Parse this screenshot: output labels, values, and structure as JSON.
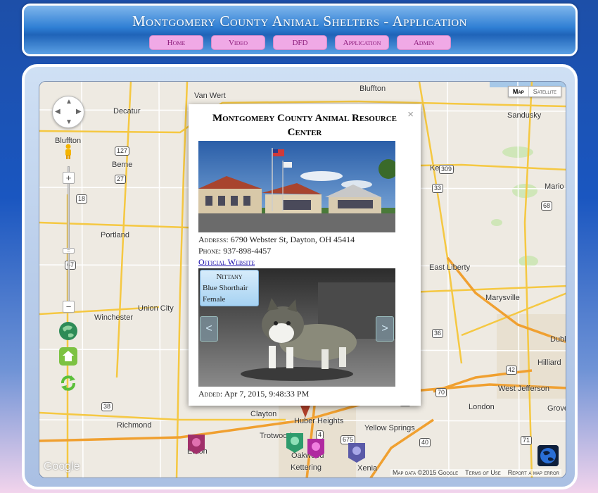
{
  "header": {
    "title": "Montgomery County Animal Shelters - Application",
    "nav": [
      {
        "label": "Home",
        "key": "home"
      },
      {
        "label": "Video",
        "key": "video"
      },
      {
        "label": "DFD",
        "key": "dfd"
      },
      {
        "label": "Application",
        "key": "application"
      },
      {
        "label": "Admin",
        "key": "admin"
      }
    ]
  },
  "map": {
    "map_type": {
      "map": "Map",
      "satellite": "Satellite",
      "selected": "Map"
    },
    "places": [
      "Van Wert",
      "Bluffton",
      "Decatur",
      "Bluffton",
      "Berne",
      "Sandusky",
      "Kenton",
      "Mario",
      "Portland",
      "East Liberty",
      "Winchester",
      "Union City",
      "Marysville",
      "Dubl",
      "Hilliard",
      "West Jefferson",
      "London",
      "Grove",
      "Richmond",
      "Clayton",
      "Huber Heights",
      "Trotwood",
      "Yellow Springs",
      "Oakwood",
      "Kettering",
      "Xenia",
      "Eaton"
    ],
    "routes": [
      "127",
      "27",
      "18",
      "67",
      "309",
      "33",
      "36",
      "42",
      "70",
      "35",
      "675",
      "71",
      "4",
      "68",
      "38",
      "40"
    ],
    "google_logo": "Google",
    "attribution": [
      "Map data ©2015 Google",
      "Terms of Use",
      "Report a map error"
    ],
    "colors": {
      "highway": "#f5c842",
      "water": "#a6c8e8",
      "park": "#cfe6b8",
      "land": "#eeeae2"
    }
  },
  "popup": {
    "title": "Montgomery County Animal Resource Center",
    "close": "×",
    "address_label": "Address:",
    "address": "6790 Webster St, Dayton, OH 45414",
    "phone_label": "Phone:",
    "phone": "937-898-4457",
    "website_label": "Official Website",
    "pet": {
      "name": "Nittany",
      "breed": "Blue Shorthair",
      "sex": "Female"
    },
    "prev": "<",
    "next": ">",
    "added_label": "Added:",
    "added": "Apr 7, 2015, 9:48:33 PM"
  }
}
